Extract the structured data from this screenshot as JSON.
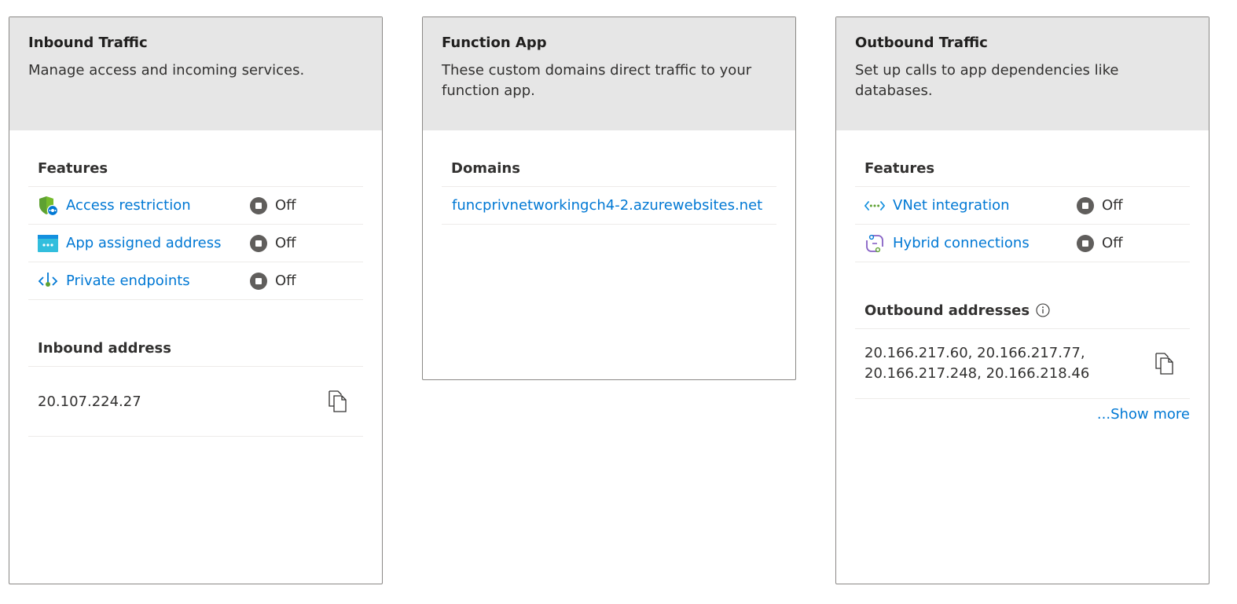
{
  "inbound": {
    "title": "Inbound Traffic",
    "description": "Manage access and incoming services.",
    "features_title": "Features",
    "features": [
      {
        "label": "Access restriction",
        "status": "Off",
        "icon": "shield-icon"
      },
      {
        "label": "App assigned address",
        "status": "Off",
        "icon": "ip-address-icon"
      },
      {
        "label": "Private endpoints",
        "status": "Off",
        "icon": "private-endpoint-icon"
      }
    ],
    "address_title": "Inbound address",
    "address": "20.107.224.27"
  },
  "function_app": {
    "title": "Function App",
    "description": "These custom domains direct traffic to your function app.",
    "domains_title": "Domains",
    "domains": [
      "funcprivnetworkingch4-2.azurewebsites.net"
    ]
  },
  "outbound": {
    "title": "Outbound Traffic",
    "description": "Set up calls to app dependencies like databases.",
    "features_title": "Features",
    "features": [
      {
        "label": "VNet integration",
        "status": "Off",
        "icon": "vnet-icon"
      },
      {
        "label": "Hybrid connections",
        "status": "Off",
        "icon": "hybrid-connection-icon"
      }
    ],
    "address_title": "Outbound addresses",
    "addresses_line1": "20.166.217.60, 20.166.217.77,",
    "addresses_line2": "20.166.217.248, 20.166.218.46",
    "show_more": "...Show more"
  },
  "colors": {
    "link": "#0078d4",
    "header_bg": "#e6e6e6",
    "status_dot": "#605e5c"
  }
}
